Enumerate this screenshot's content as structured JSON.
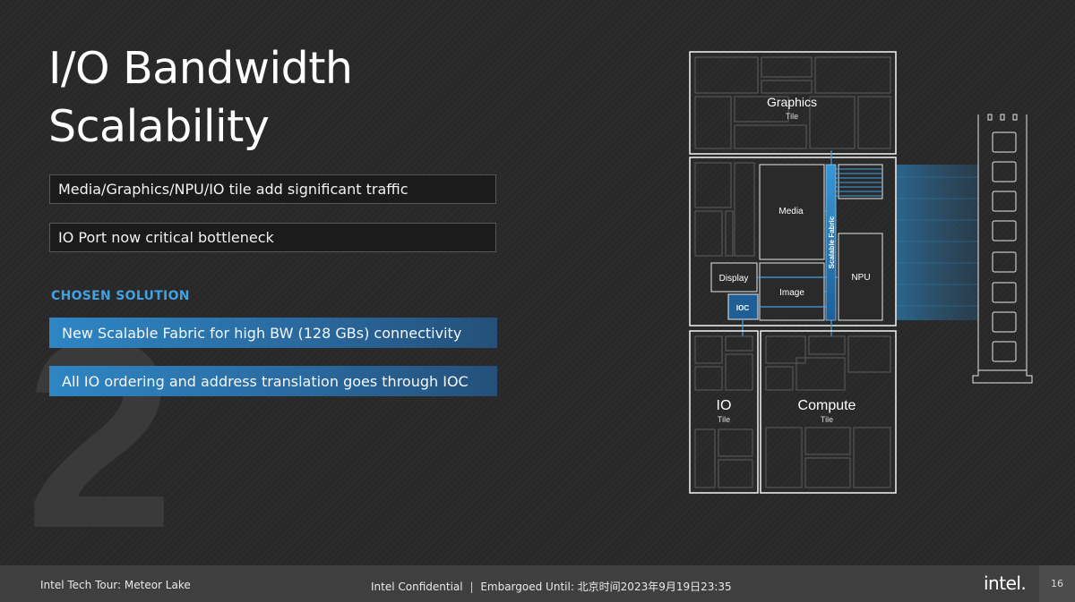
{
  "slide": {
    "big_number": "2",
    "title_line1": "I/O Bandwidth",
    "title_line2": "Scalability",
    "issues": [
      "Media/Graphics/NPU/IO tile add significant traffic",
      "IO Port now critical bottleneck"
    ],
    "solution_heading": "CHOSEN SOLUTION",
    "solutions": [
      "New Scalable Fabric for high BW (128 GBs) connectivity",
      "All IO ordering and address translation goes through IOC"
    ]
  },
  "diagram": {
    "graphics_tile": {
      "name": "Graphics",
      "sub": "Tile"
    },
    "soc_blocks": {
      "media": "Media",
      "display": "Display",
      "image": "Image",
      "ioc": "IOC",
      "npu": "NPU",
      "fabric": "Scalable Fabric"
    },
    "io_tile": {
      "name": "IO",
      "sub": "Tile"
    },
    "compute_tile": {
      "name": "Compute",
      "sub": "Tile"
    },
    "colors": {
      "fabric": "#2b7fc0",
      "ioc": "#1f5f96",
      "link_line": "#3fa2e4",
      "outline": "#e8e8e8"
    }
  },
  "footer": {
    "event": "Intel Tech Tour: Meteor Lake",
    "confidential": "Intel Confidential",
    "separator": "|",
    "embargo": "Embargoed Until: 北京时间2023年9月19日23:35",
    "logo": "intel.",
    "page_number": "16"
  }
}
